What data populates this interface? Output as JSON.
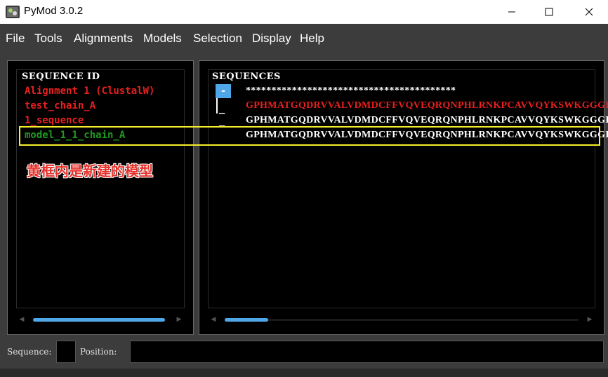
{
  "window": {
    "title": "PyMod 3.0.2",
    "controls": {
      "minimize": "minimize-icon",
      "maximize": "maximize-icon",
      "close": "close-icon"
    }
  },
  "menu": [
    "File",
    "Tools",
    "Alignments",
    "Models",
    "Selection",
    "Display",
    "Help"
  ],
  "left_panel": {
    "header": "SEQUENCE ID",
    "items": [
      {
        "label": "Alignment 1 (ClustalW)",
        "color": "#e8201e"
      },
      {
        "label": "test_chain_A",
        "color": "#e8201e"
      },
      {
        "label": "1_sequence",
        "color": "#e8201e"
      },
      {
        "label": "model_1_1_chain_A",
        "color": "#1f9a1f"
      }
    ]
  },
  "right_panel": {
    "header": "SEQUENCES",
    "collapse_button": "-",
    "tree_marks": [
      "_",
      "_"
    ],
    "lines": [
      {
        "text": "*****************************************",
        "color": "#ffffff"
      },
      {
        "text": "GPHMATGQDRVVALVDMDCFFVQVEQRQNPHLRNKPCAVVQYKSWKGGGI",
        "color": "#e8201e"
      },
      {
        "text": "GPHMATGQDRVVALVDMDCFFVQVEQRQNPHLRNKPCAVVQYKSWKGGGI",
        "color": "#ffffff"
      },
      {
        "text": "GPHMATGQDRVVALVDMDCFFVQVEQRQNPHLRNKPCAVVQYKSWKGGGI",
        "color": "#ffffff"
      }
    ]
  },
  "annotation": "黄框内是新建的模型",
  "bottom": {
    "sequence_label": "Sequence:",
    "position_label": "Position:",
    "sequence_value": "",
    "position_value": ""
  },
  "colors": {
    "accent": "#4fa7e8",
    "highlight_box": "#f5ee2b",
    "annotation": "#e8302a"
  }
}
